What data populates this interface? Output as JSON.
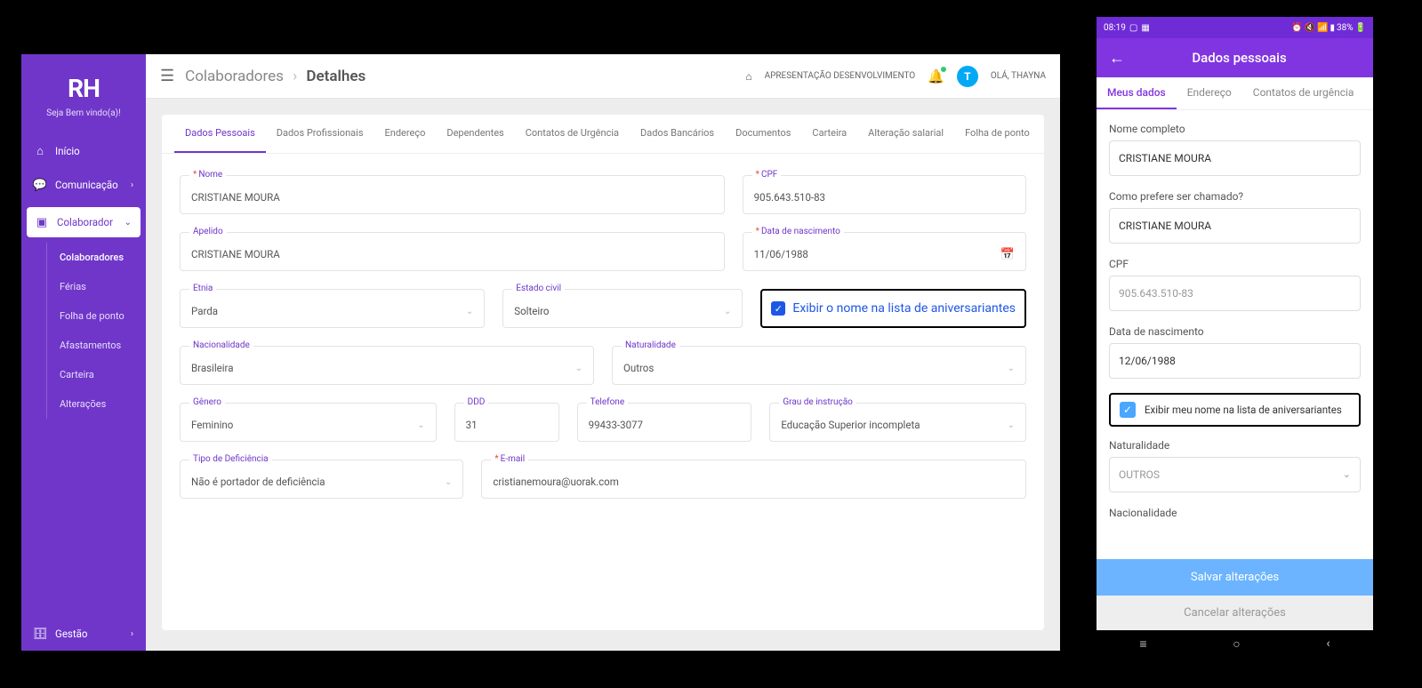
{
  "desktop": {
    "logo": "RH",
    "welcome": "Seja Bem vindo(a)!",
    "nav": {
      "inicio": "Início",
      "comunicacao": "Comunicação",
      "colaborador": "Colaborador",
      "gestao": "Gestão"
    },
    "subnav": {
      "colaboradores": "Colaboradores",
      "ferias": "Férias",
      "folha": "Folha de ponto",
      "afastamentos": "Afastamentos",
      "carteira": "Carteira",
      "alteracoes": "Alterações"
    },
    "topbar": {
      "crumb_parent": "Colaboradores",
      "crumb_current": "Detalhes",
      "presentation": "APRESENTAÇÃO DESENVOLVIMENTO",
      "greeting": "OLÁ, THAYNA",
      "avatar_letter": "T"
    },
    "tabs": {
      "t0": "Dados Pessoais",
      "t1": "Dados Profissionais",
      "t2": "Endereço",
      "t3": "Dependentes",
      "t4": "Contatos de Urgência",
      "t5": "Dados Bancários",
      "t6": "Documentos",
      "t7": "Carteira",
      "t8": "Alteração salarial",
      "t9": "Folha de ponto"
    },
    "labels": {
      "nome": "Nome",
      "cpf": "CPF",
      "apelido": "Apelido",
      "nascimento": "Data de nascimento",
      "etnia": "Etnia",
      "estado_civil": "Estado civil",
      "aniversariantes": "Exibir o nome na lista de aniversariantes",
      "nacionalidade": "Nacionalidade",
      "naturalidade": "Naturalidade",
      "genero": "Gênero",
      "ddd": "DDD",
      "telefone": "Telefone",
      "grau": "Grau de instrução",
      "deficiencia": "Tipo de Deficiência",
      "email": "E-mail"
    },
    "values": {
      "nome": "CRISTIANE MOURA",
      "cpf": "905.643.510-83",
      "apelido": "CRISTIANE MOURA",
      "nascimento": "11/06/1988",
      "etnia": "Parda",
      "estado_civil": "Solteiro",
      "nacionalidade": "Brasileira",
      "naturalidade": "Outros",
      "genero": "Feminino",
      "ddd": "31",
      "telefone": "99433-3077",
      "grau": "Educação Superior incompleta",
      "deficiencia": "Não é portador de deficiência",
      "email": "cristianemoura@uorak.com"
    }
  },
  "mobile": {
    "status_time": "08:19",
    "status_battery": "38%",
    "header_title": "Dados pessoais",
    "tabs": {
      "t0": "Meus dados",
      "t1": "Endereço",
      "t2": "Contatos de urgência"
    },
    "labels": {
      "nome": "Nome completo",
      "apelido": "Como prefere ser chamado?",
      "cpf": "CPF",
      "nascimento": "Data de nascimento",
      "aniversariantes": "Exibir meu nome na lista de aniversariantes",
      "naturalidade": "Naturalidade",
      "nacionalidade": "Nacionalidade"
    },
    "values": {
      "nome": "CRISTIANE MOURA",
      "apelido": "CRISTIANE MOURA",
      "cpf": "905.643.510-83",
      "nascimento": "12/06/1988",
      "naturalidade": "OUTROS"
    },
    "btn_save": "Salvar alterações",
    "btn_cancel": "Cancelar alterações"
  }
}
